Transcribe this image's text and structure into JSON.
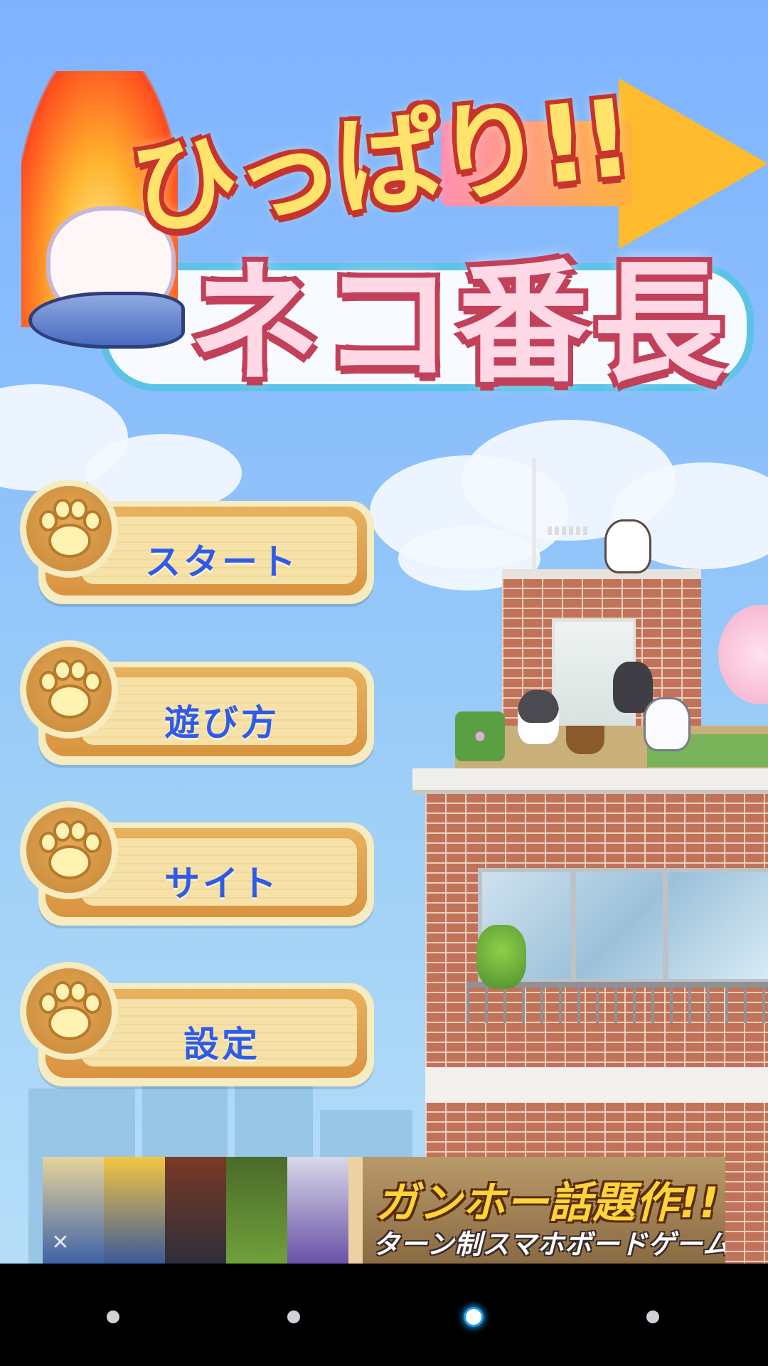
{
  "title": {
    "line1": "ひっぱり!!",
    "line2": "ネコ番長"
  },
  "menu": {
    "items": [
      {
        "label": "スタート",
        "name": "start-button"
      },
      {
        "label": "遊び方",
        "name": "how-to-play-button"
      },
      {
        "label": "サイト",
        "name": "site-button"
      },
      {
        "label": "設定",
        "name": "settings-button"
      }
    ]
  },
  "ad": {
    "headline": "ガンホー話題作!!",
    "subline": "ターン制スマホボードゲーム",
    "close_icon": "close-icon"
  },
  "nav": {
    "dots": 4,
    "active_index": 2
  },
  "colors": {
    "sky": "#8cc0fb",
    "button_label": "#2f5be8",
    "button_wood": "#d9933f",
    "title_outline": "#c8342b",
    "active_dot_glow": "#1aa7ff"
  }
}
